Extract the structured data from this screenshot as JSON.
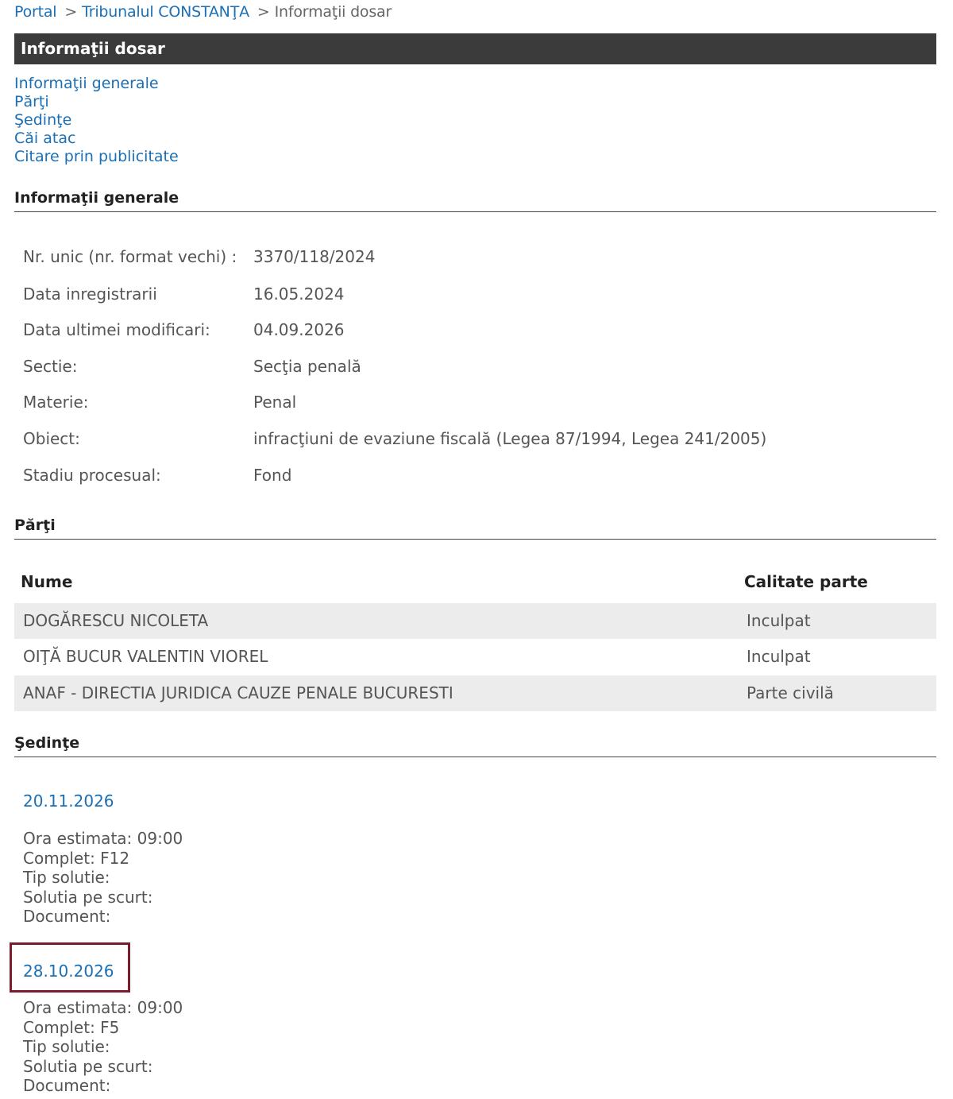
{
  "breadcrumb": {
    "items": [
      "Portal",
      "Tribunalul CONSTANŢA"
    ],
    "current": "Informaţii dosar",
    "separator": ">"
  },
  "title": "Informaţii dosar",
  "nav": [
    "Informaţii generale",
    "Părţi",
    "Şedinţe",
    "Căi atac",
    "Citare prin publicitate"
  ],
  "general": {
    "heading": "Informaţii generale",
    "rows": [
      {
        "label": "Nr. unic (nr. format vechi) :",
        "value": "3370/118/2024"
      },
      {
        "label": "Data inregistrarii",
        "value": "16.05.2024"
      },
      {
        "label": "Data ultimei modificari:",
        "value": "04.09.2026"
      },
      {
        "label": "Sectie:",
        "value": "Secţia penală"
      },
      {
        "label": "Materie:",
        "value": "Penal"
      },
      {
        "label": "Obiect:",
        "value": "infracţiuni de evaziune fiscală (Legea 87/1994, Legea 241/2005)"
      },
      {
        "label": "Stadiu procesual:",
        "value": "Fond"
      }
    ]
  },
  "parti": {
    "heading": "Părţi",
    "col_name": "Nume",
    "col_role": "Calitate parte",
    "rows": [
      {
        "name": "DOGĂRESCU NICOLETA",
        "role": "Inculpat"
      },
      {
        "name": "OIŢĂ BUCUR VALENTIN VIOREL",
        "role": "Inculpat"
      },
      {
        "name": "ANAF - DIRECTIA JURIDICA CAUZE PENALE BUCURESTI",
        "role": "Parte civilă"
      }
    ]
  },
  "sedinte": {
    "heading": "Şedinţe",
    "items": [
      {
        "date": "20.11.2026",
        "lines": [
          "Ora estimata: 09:00",
          "Complet: F12",
          "Tip solutie:",
          "Solutia pe scurt:",
          "Document:"
        ]
      },
      {
        "date": "28.10.2026",
        "lines": [
          "Ora estimata: 09:00",
          "Complet: F5",
          "Tip solutie:",
          "Solutia pe scurt:",
          "Document:"
        ]
      }
    ]
  },
  "colors": {
    "link": "#1a6fb5",
    "titlebar": "#3b3b3b",
    "row_shade": "#ececec",
    "highlight_border": "#7b1c2c"
  }
}
